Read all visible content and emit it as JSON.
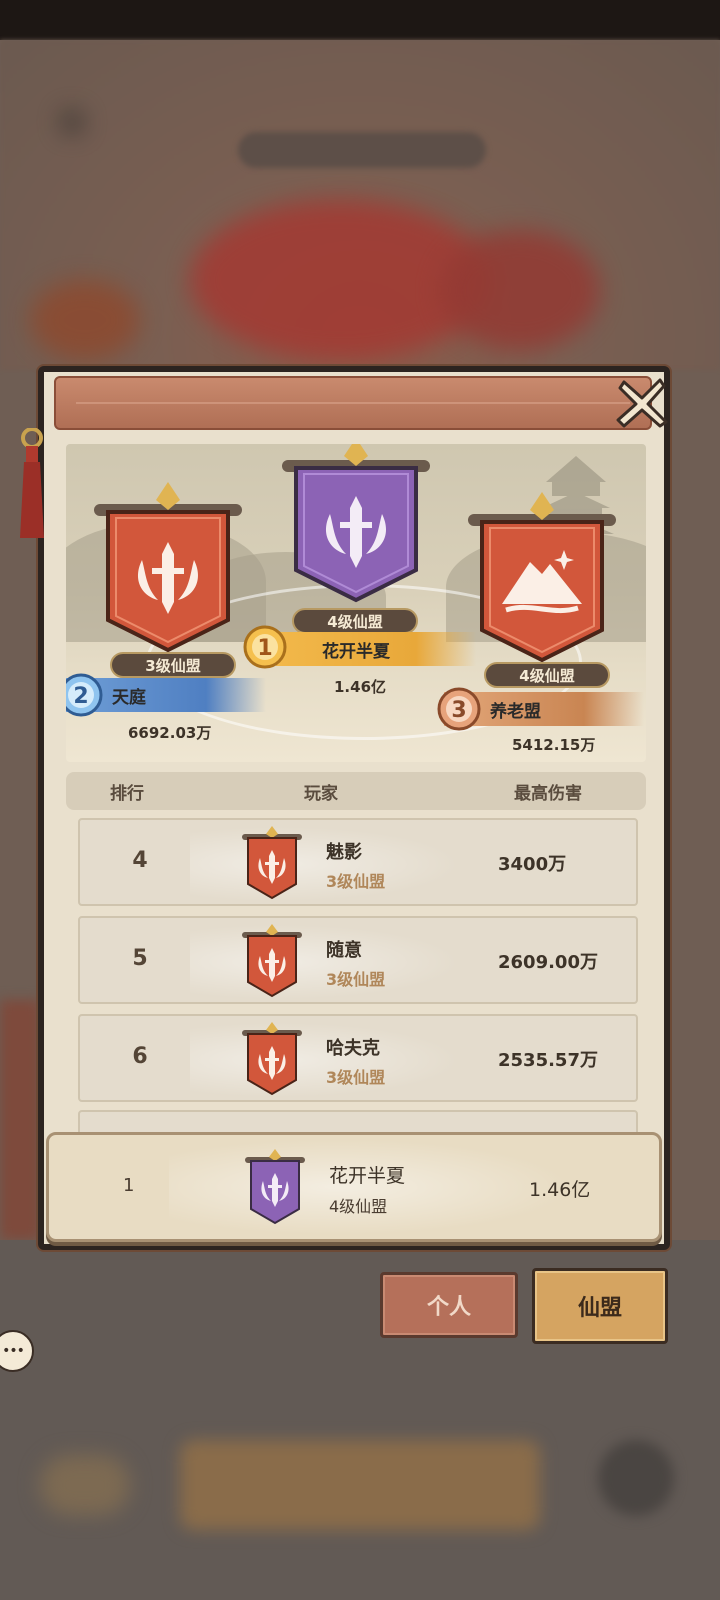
{
  "podium": [
    {
      "rank": "1",
      "level": "4级仙盟",
      "name": "花开半夏",
      "damage": "1.46亿",
      "color": "#8c63b5"
    },
    {
      "rank": "2",
      "level": "3级仙盟",
      "name": "天庭",
      "damage": "6692.03万",
      "color": "#d2573b"
    },
    {
      "rank": "3",
      "level": "4级仙盟",
      "name": "养老盟",
      "damage": "5412.15万",
      "color": "#d2573b"
    }
  ],
  "table": {
    "headers": {
      "rank": "排行",
      "player": "玩家",
      "damage": "最高伤害"
    },
    "rows": [
      {
        "rank": "4",
        "name": "魅影",
        "level": "3级仙盟",
        "damage": "3400万"
      },
      {
        "rank": "5",
        "name": "随意",
        "level": "3级仙盟",
        "damage": "2609.00万"
      },
      {
        "rank": "6",
        "name": "哈夫克",
        "level": "3级仙盟",
        "damage": "2535.57万"
      }
    ]
  },
  "my_rank": {
    "rank": "1",
    "name": "花开半夏",
    "level": "4级仙盟",
    "damage": "1.46亿"
  },
  "tabs": {
    "personal": "个人",
    "alliance": "仙盟",
    "active": "alliance"
  },
  "icons": {
    "close": "close-icon",
    "chat": "chat-bubble-icon",
    "banner": "alliance-banner-icon"
  }
}
